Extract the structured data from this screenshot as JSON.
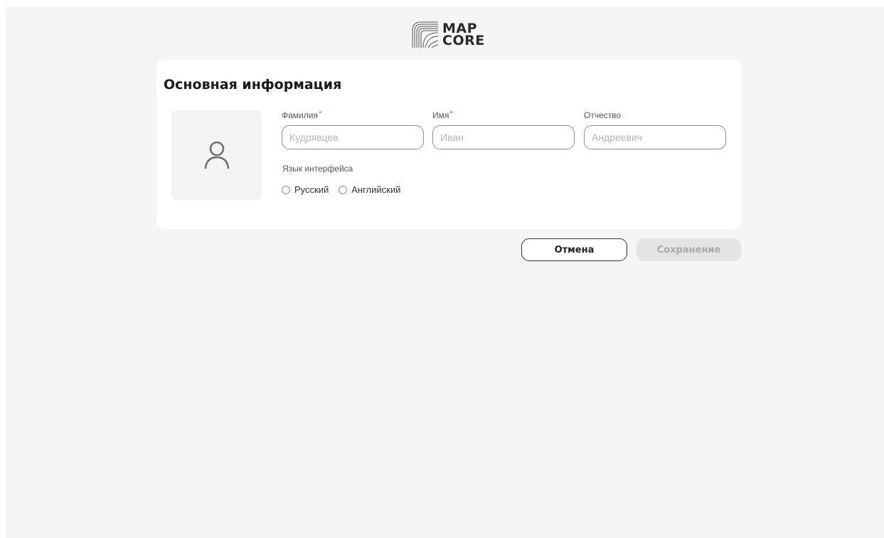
{
  "logo": {
    "line1": "MAP",
    "line2": "CORE",
    "icon": "topographic-lines-icon"
  },
  "card": {
    "title": "Основная информация",
    "avatar_icon": "user-icon"
  },
  "fields": {
    "last_name": {
      "label": "Фамилия",
      "required_mark": "*",
      "placeholder": "Кудрявцев",
      "value": ""
    },
    "first_name": {
      "label": "Имя",
      "required_mark": "*",
      "placeholder": "Иван",
      "value": ""
    },
    "patronymic": {
      "label": "Отчество",
      "placeholder": "Андреевич",
      "value": ""
    }
  },
  "language": {
    "label": "Язык интерфейса",
    "options": [
      {
        "label": "Русский",
        "selected": false
      },
      {
        "label": "Английский",
        "selected": false
      }
    ]
  },
  "actions": {
    "cancel_label": "Отмена",
    "save_label": "Сохранение",
    "save_disabled": true
  },
  "colors": {
    "page_background": "#f5f5f5",
    "card_background": "#ffffff",
    "required_mark": "#d9534f",
    "disabled_button": "#e4e4e4",
    "disabled_text": "#a9a9a9"
  }
}
